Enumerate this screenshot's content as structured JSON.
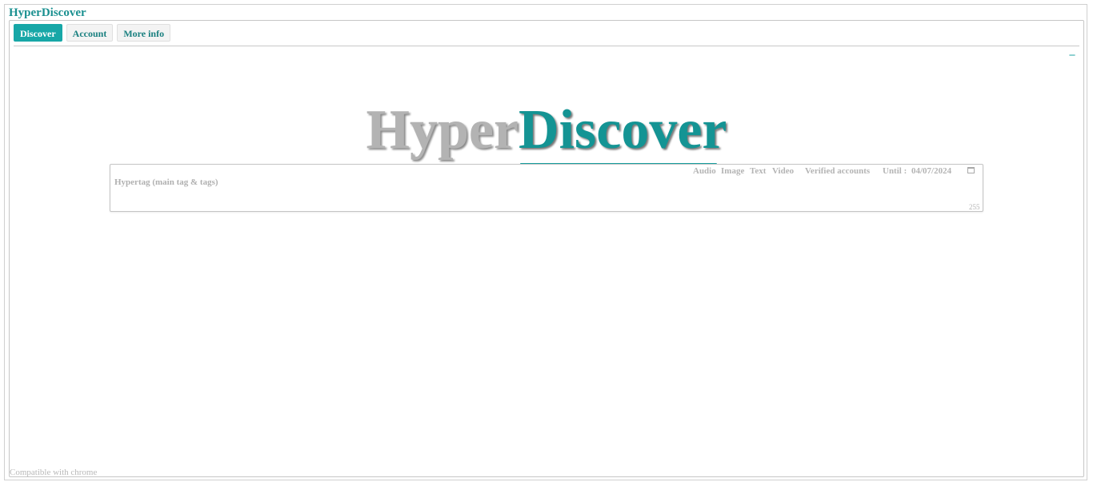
{
  "app": {
    "title": "HyperDiscover"
  },
  "tabs": [
    {
      "label": "Discover",
      "active": true
    },
    {
      "label": "Account",
      "active": false
    },
    {
      "label": "More info",
      "active": false
    }
  ],
  "collapse": {
    "label": "–"
  },
  "logo": {
    "part1": "Hyper",
    "part2": "Discover"
  },
  "search": {
    "placeholder": "Hypertag (main tag & tags)",
    "value": "",
    "char_count": "255",
    "filters": [
      "Audio",
      "Image",
      "Text",
      "Video",
      "Verified accounts"
    ],
    "until_label": "Until :",
    "date": "04/07/2024",
    "calendar_icon": "calendar-icon"
  },
  "footer": {
    "note": "Compatible with chrome"
  },
  "colors": {
    "accent": "#17a7a7",
    "brand_dark": "#149494",
    "logo_gray": "#b3b3b3"
  }
}
